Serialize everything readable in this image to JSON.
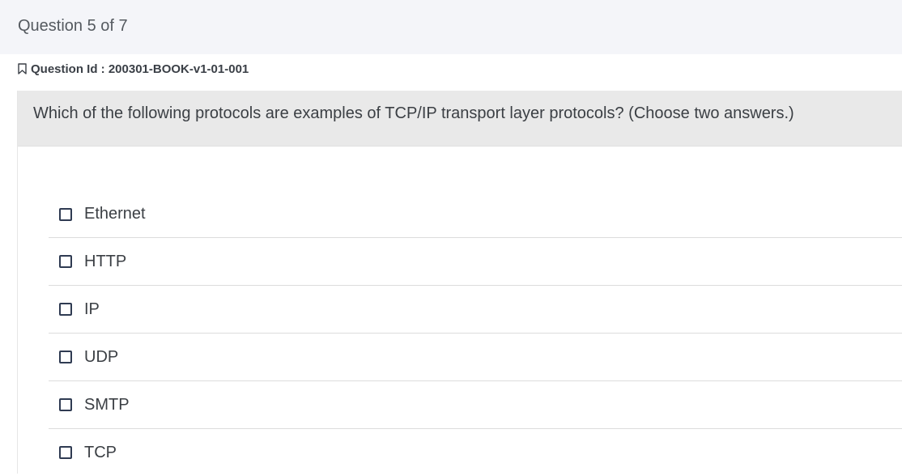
{
  "header": {
    "progress_text": "Question 5 of 7"
  },
  "question": {
    "id_label": "Question Id : 200301-BOOK-v1-01-001",
    "bookmark_icon": "bookmark-outline-icon",
    "text": "Which of the following protocols are examples of TCP/IP transport layer protocols? (Choose two answers.)"
  },
  "options": [
    {
      "label": "Ethernet",
      "checked": false
    },
    {
      "label": "HTTP",
      "checked": false
    },
    {
      "label": "IP",
      "checked": false
    },
    {
      "label": "UDP",
      "checked": false
    },
    {
      "label": "SMTP",
      "checked": false
    },
    {
      "label": "TCP",
      "checked": false
    }
  ],
  "colors": {
    "topbar_bg": "#f4f5f9",
    "question_bg": "#e9e9e9",
    "checkbox_border": "#2f3b52"
  }
}
